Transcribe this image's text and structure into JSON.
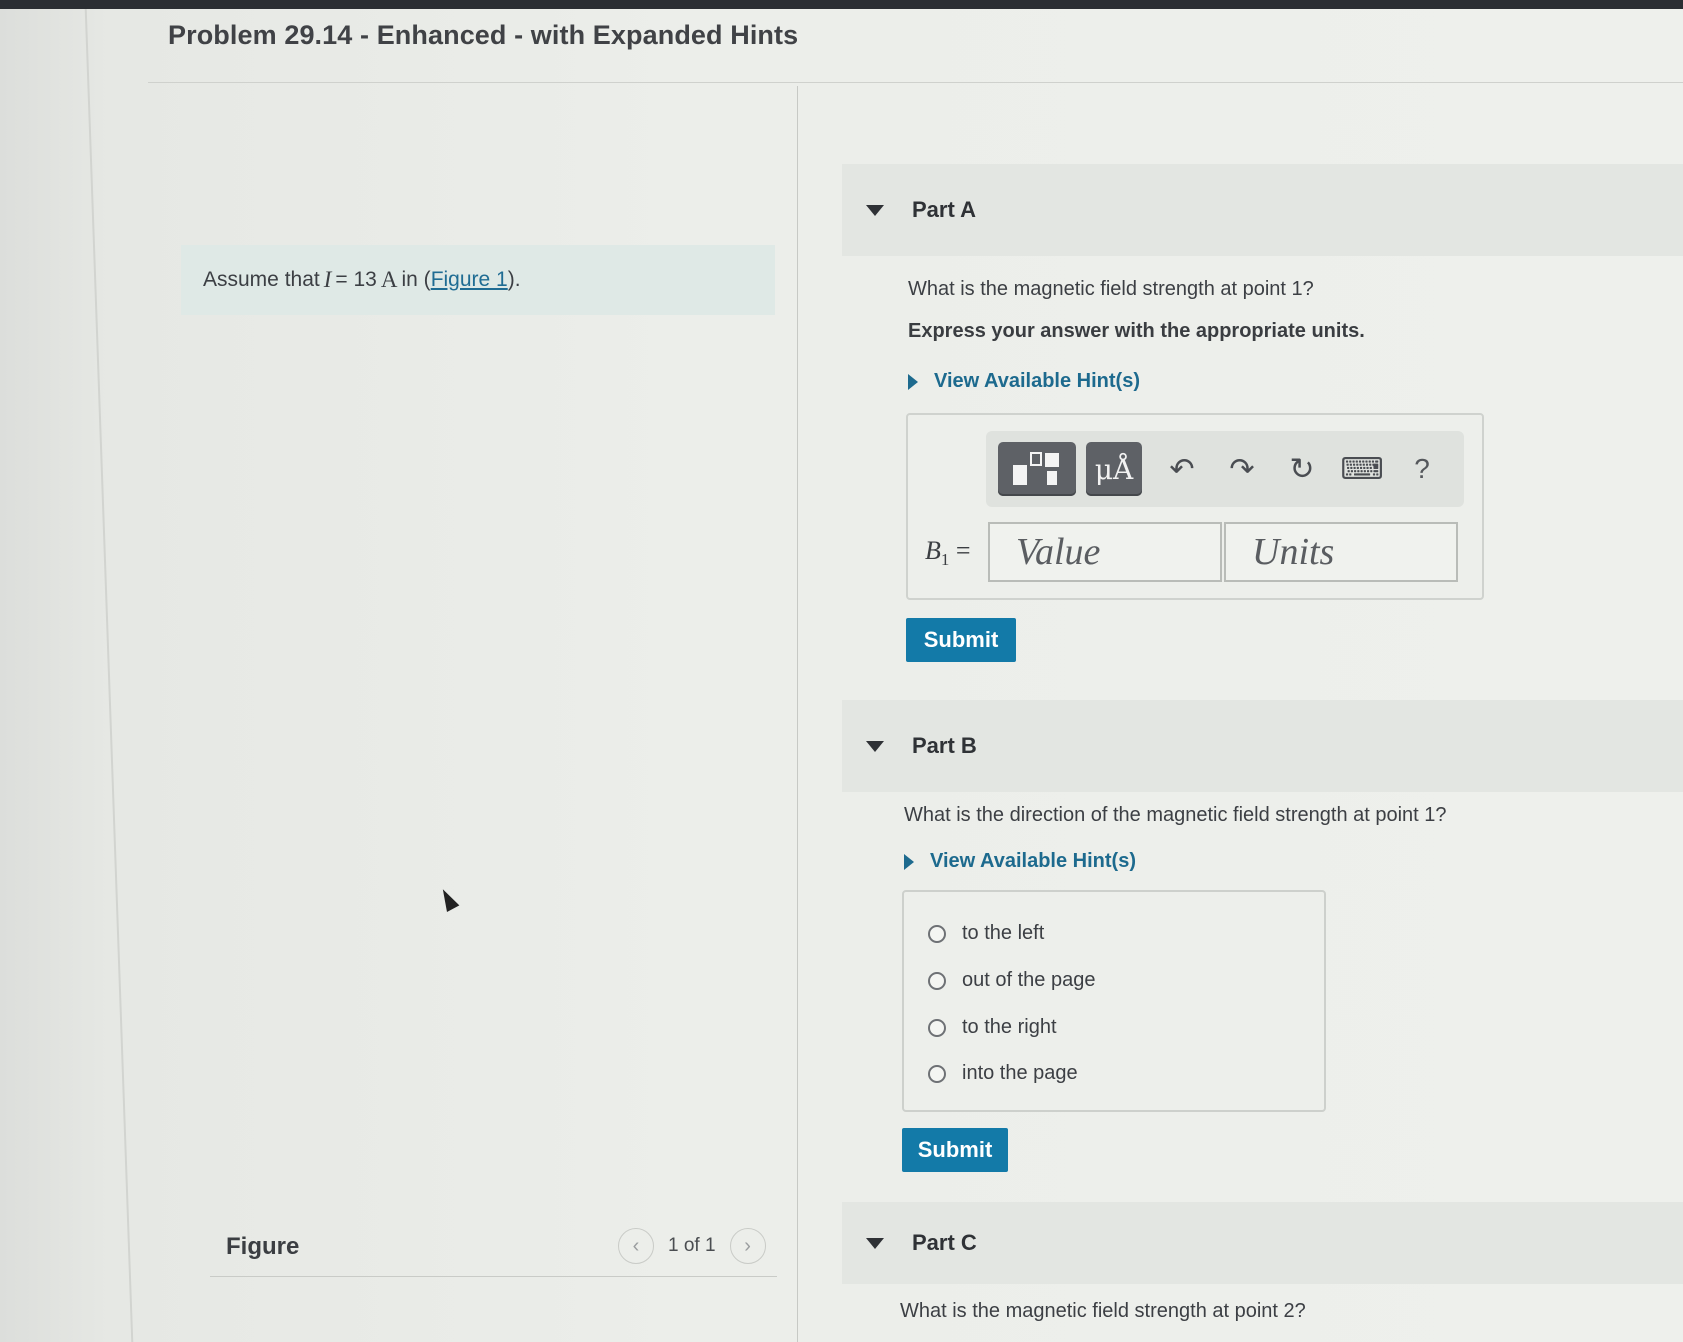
{
  "title": "Problem 29.14 - Enhanced - with Expanded Hints",
  "assume": {
    "prefix": "Assume that",
    "var": "I",
    "equals": "= 13",
    "unit": "A",
    "in": "in (",
    "figure_link": "Figure 1",
    "suffix": ")."
  },
  "figure": {
    "label": "Figure",
    "page": "1 of 1",
    "prev_icon": "chevron-left",
    "next_icon": "chevron-right"
  },
  "partA": {
    "label": "Part A",
    "question": "What is the magnetic field strength at point 1?",
    "instruction": "Express your answer with the appropriate units.",
    "hints": "View Available Hint(s)",
    "toolbar": {
      "templates_icon": "templates-icon",
      "units_symbol": "μÅ",
      "undo": "↶",
      "redo": "↷",
      "reset": "↻",
      "keyboard": "⌨",
      "help": "?"
    },
    "variable": "B",
    "subscript": "1",
    "equals": "=",
    "value_placeholder": "Value",
    "units_placeholder": "Units",
    "submit": "Submit"
  },
  "partB": {
    "label": "Part B",
    "question": "What is the direction of the magnetic field strength at point 1?",
    "hints": "View Available Hint(s)",
    "options": [
      "to the left",
      "out of the page",
      "to the right",
      "into the page"
    ],
    "submit": "Submit"
  },
  "partC": {
    "label": "Part C",
    "question": "What is the magnetic field strength at point 2?"
  }
}
